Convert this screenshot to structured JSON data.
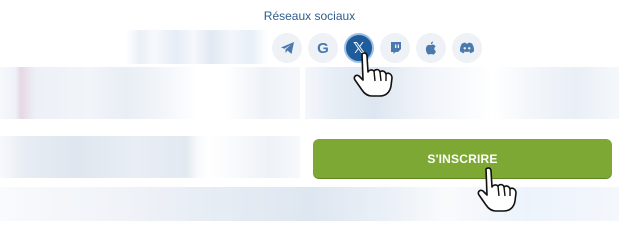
{
  "social": {
    "title": "Réseaux sociaux",
    "items": [
      {
        "name": "telegram-icon",
        "glyph": "telegram"
      },
      {
        "name": "google-icon",
        "glyph": "G"
      },
      {
        "name": "x-twitter-icon",
        "glyph": "𝕏",
        "active": true
      },
      {
        "name": "twitch-icon",
        "glyph": "twitch"
      },
      {
        "name": "apple-icon",
        "glyph": "apple"
      },
      {
        "name": "discord-icon",
        "glyph": "discord"
      }
    ]
  },
  "form": {
    "submit_label": "S'INSCRIRE"
  },
  "colors": {
    "accent_green": "#7da833",
    "link_blue": "#2f5c8e",
    "active_icon_bg": "#1f5c9c",
    "icon_bg": "#eef1f5"
  }
}
